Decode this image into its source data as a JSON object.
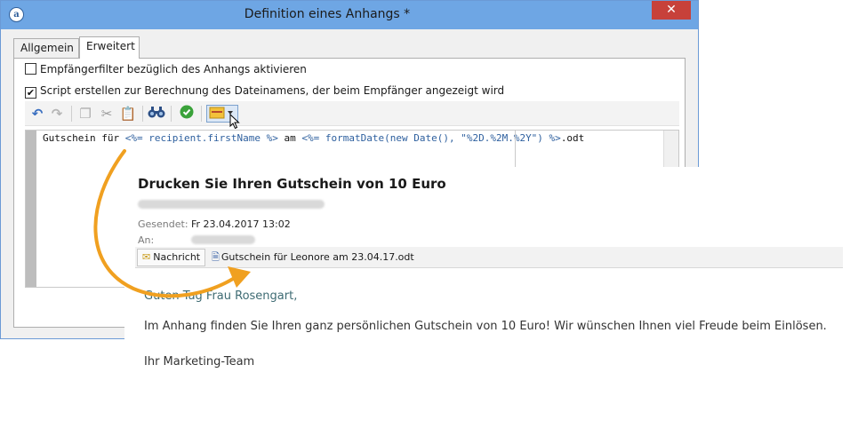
{
  "window": {
    "title": "Definition eines Anhangs *",
    "close_label": "✕"
  },
  "tabs": [
    {
      "label": "Allgemein",
      "active": false
    },
    {
      "label": "Erweitert",
      "active": true
    }
  ],
  "options": [
    {
      "label": "Empfängerfilter bezüglich des Anhangs aktivieren",
      "checked": false
    },
    {
      "label": "Script erstellen zur Berechnung des Dateinamens, der beim Empfänger angezeigt wird",
      "checked": true
    }
  ],
  "toolbar": {
    "icons": [
      "undo-icon",
      "redo-icon",
      "copy-icon",
      "cut-icon",
      "paste-icon",
      "find-icon",
      "check-icon",
      "insert-field-icon"
    ]
  },
  "editor": {
    "code_parts": {
      "a": "Gutschein für ",
      "b": "<%= recipient.firstName %>",
      "c": " am ",
      "d": "<%= formatDate(new Date(), \"%2D.%2M.%2Y\") %>",
      "e": ".odt"
    }
  },
  "mail": {
    "subject": "Drucken Sie Ihren Gutschein von 10 Euro",
    "sent_label": "Gesendet:",
    "sent_value": "Fr 23.04.2017 13:02",
    "to_label": "An:",
    "message_tab": "Nachricht",
    "attachment": "Gutschein für Leonore am 23.04.17.odt",
    "greeting": "Guten Tag Frau Rosengart,",
    "paragraph": "Im Anhang finden Sie Ihren ganz persönlichen Gutschein von 10 Euro! Wir wünschen Ihnen viel Freude beim Einlösen.",
    "signature": "Ihr Marketing-Team"
  },
  "colors": {
    "titlebar": "#6ea6e4",
    "close": "#c7413a",
    "arrow": "#f0a020",
    "accent_text": "#3e6b73"
  }
}
